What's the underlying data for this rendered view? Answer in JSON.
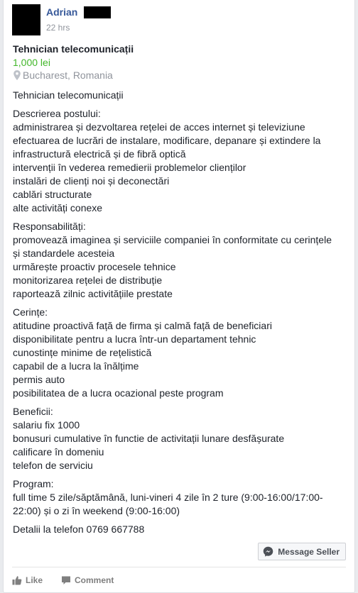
{
  "post": {
    "author": "Adrian",
    "time": "22 hrs"
  },
  "listing": {
    "title": "Tehnician telecomunicații",
    "price": "1,000 lei",
    "location": "Bucharest, Romania",
    "pin_icon": "location-pin-icon"
  },
  "description": [
    [
      "Tehnician telecomunicații"
    ],
    [
      "Descrierea postului:",
      "administrarea și dezvoltarea rețelei de acces internet și televiziune",
      "efectuarea de lucrări de instalare, modificare, depanare și extindere la",
      "infrastructură electrică și de fibră optică",
      "intervenții în vederea remedierii problemelor clienților",
      "instalări de clienți noi și deconectări",
      "cablări structurate",
      "alte activități conexe"
    ],
    [
      "Responsabilități:",
      "promovează imaginea și serviciile companiei în conformitate cu cerințele",
      "și standardele acesteia",
      "urmărește proactiv procesele tehnice",
      "monitorizarea rețelei de distribuție",
      "raportează zilnic activitățiile prestate"
    ],
    [
      "Cerințe:",
      "atitudine proactivă față de firma și calmă față de beneficiari",
      "disponibilitate pentru a lucra într-un departament tehnic",
      "cunostințe minime de rețelistică",
      "capabil de a lucra la înălțime",
      "permis auto",
      "posibilitatea de a lucra ocazional peste program"
    ],
    [
      "Beneficii:",
      "salariu fix 1000",
      "bonusuri cumulative în functie de activitații lunare desfășurate",
      "calificare în domeniu",
      "telefon de serviciu"
    ],
    [
      "Program:",
      "full time 5 zile/săptămână, luni-vineri 4 zile în 2 ture (9:00-16:00/17:00-",
      "22:00) și o zi în weekend (9:00-16:00)"
    ],
    [
      "Detalii la telefon 0769 667788"
    ]
  ],
  "buttons": {
    "message_seller": "Message Seller",
    "message_icon": "messenger-icon",
    "like": "Like",
    "like_icon": "thumbs-up-icon",
    "comment": "Comment",
    "comment_icon": "comment-icon"
  },
  "colors": {
    "link": "#365899",
    "price": "#42b72a",
    "muted": "#90949c"
  }
}
